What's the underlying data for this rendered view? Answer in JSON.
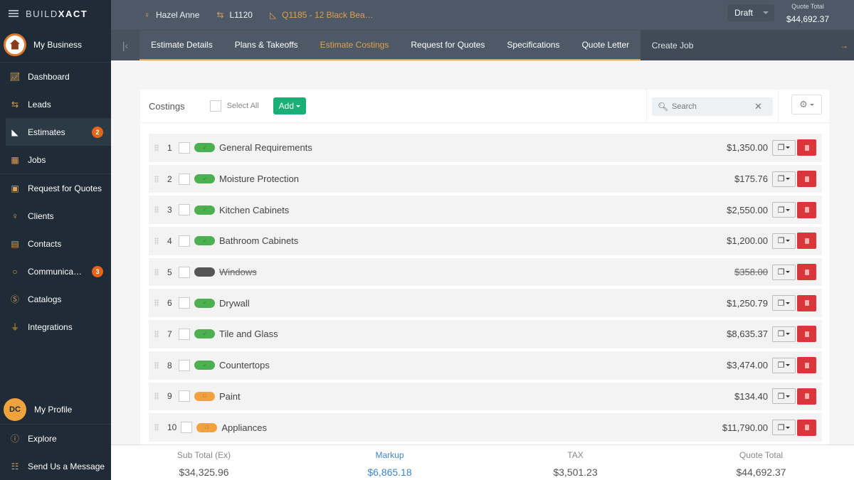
{
  "app": {
    "brand_light": "BUILD",
    "brand_bold": "XACT"
  },
  "sidebar": {
    "business_label": "My Business",
    "items": [
      {
        "label": "Dashboard",
        "icon": "chart-icon"
      },
      {
        "label": "Leads",
        "icon": "swap-arrows-icon"
      },
      {
        "label": "Estimates",
        "icon": "set-square-icon",
        "badge": "2",
        "active": true
      },
      {
        "label": "Jobs",
        "icon": "calendar-icon"
      },
      {
        "label": "Request for Quotes",
        "icon": "document-dollar-icon"
      },
      {
        "label": "Clients",
        "icon": "user-icon"
      },
      {
        "label": "Contacts",
        "icon": "contact-book-icon"
      },
      {
        "label": "Communica…",
        "icon": "chat-bubble-icon",
        "badge": "3"
      },
      {
        "label": "Catalogs",
        "icon": "dollar-circle-icon"
      },
      {
        "label": "Integrations",
        "icon": "plug-icon"
      }
    ],
    "profile": {
      "initials": "DC",
      "label": "My Profile"
    },
    "explore_label": "Explore",
    "message_label": "Send Us a Message"
  },
  "header": {
    "client": "Hazel Anne",
    "lead": "L1120",
    "quote": "Q1185 - 12 Black Bea…",
    "status": "Draft",
    "quote_total_label": "Quote Total",
    "quote_total_value": "$44,692.37"
  },
  "tabs": [
    {
      "label": "Estimate Details"
    },
    {
      "label": "Plans & Takeoffs"
    },
    {
      "label": "Estimate Costings",
      "active": true
    },
    {
      "label": "Request for Quotes"
    },
    {
      "label": "Specifications"
    },
    {
      "label": "Quote Letter"
    },
    {
      "label": "Create Job"
    }
  ],
  "costings": {
    "title": "Costings",
    "select_all_label": "Select All",
    "add_label": "Add",
    "search_placeholder": "Search",
    "rows": [
      {
        "num": "1",
        "name": "General Requirements",
        "amount": "$1,350.00",
        "status": "approved"
      },
      {
        "num": "2",
        "name": "Moisture Protection",
        "amount": "$175.76",
        "status": "approved"
      },
      {
        "num": "3",
        "name": "Kitchen Cabinets",
        "amount": "$2,550.00",
        "status": "approved"
      },
      {
        "num": "4",
        "name": "Bathroom Cabinets",
        "amount": "$1,200.00",
        "status": "approved"
      },
      {
        "num": "5",
        "name": "Windows",
        "amount": "$358.00",
        "status": "excluded"
      },
      {
        "num": "6",
        "name": "Drywall",
        "amount": "$1,250.79",
        "status": "approved"
      },
      {
        "num": "7",
        "name": "Tile and Glass",
        "amount": "$8,635.37",
        "status": "approved"
      },
      {
        "num": "8",
        "name": "Countertops",
        "amount": "$3,474.00",
        "status": "approved"
      },
      {
        "num": "9",
        "name": "Paint",
        "amount": "$134.40",
        "status": "pending"
      },
      {
        "num": "10",
        "name": "Appliances",
        "amount": "$11,790.00",
        "status": "pending"
      }
    ]
  },
  "totals": {
    "subtotal_label": "Sub Total (Ex)",
    "subtotal_value": "$34,325.96",
    "markup_label": "Markup",
    "markup_value": "$6,865.18",
    "tax_label": "TAX",
    "tax_value": "$3,501.23",
    "quote_total_label": "Quote Total",
    "quote_total_value": "$44,692.37"
  },
  "colors": {
    "accent": "#e0a04d",
    "add_green": "#1aaf75",
    "delete_red": "#d9353a",
    "markup_blue": "#3b86d1",
    "badge_orange": "#e8641b"
  }
}
